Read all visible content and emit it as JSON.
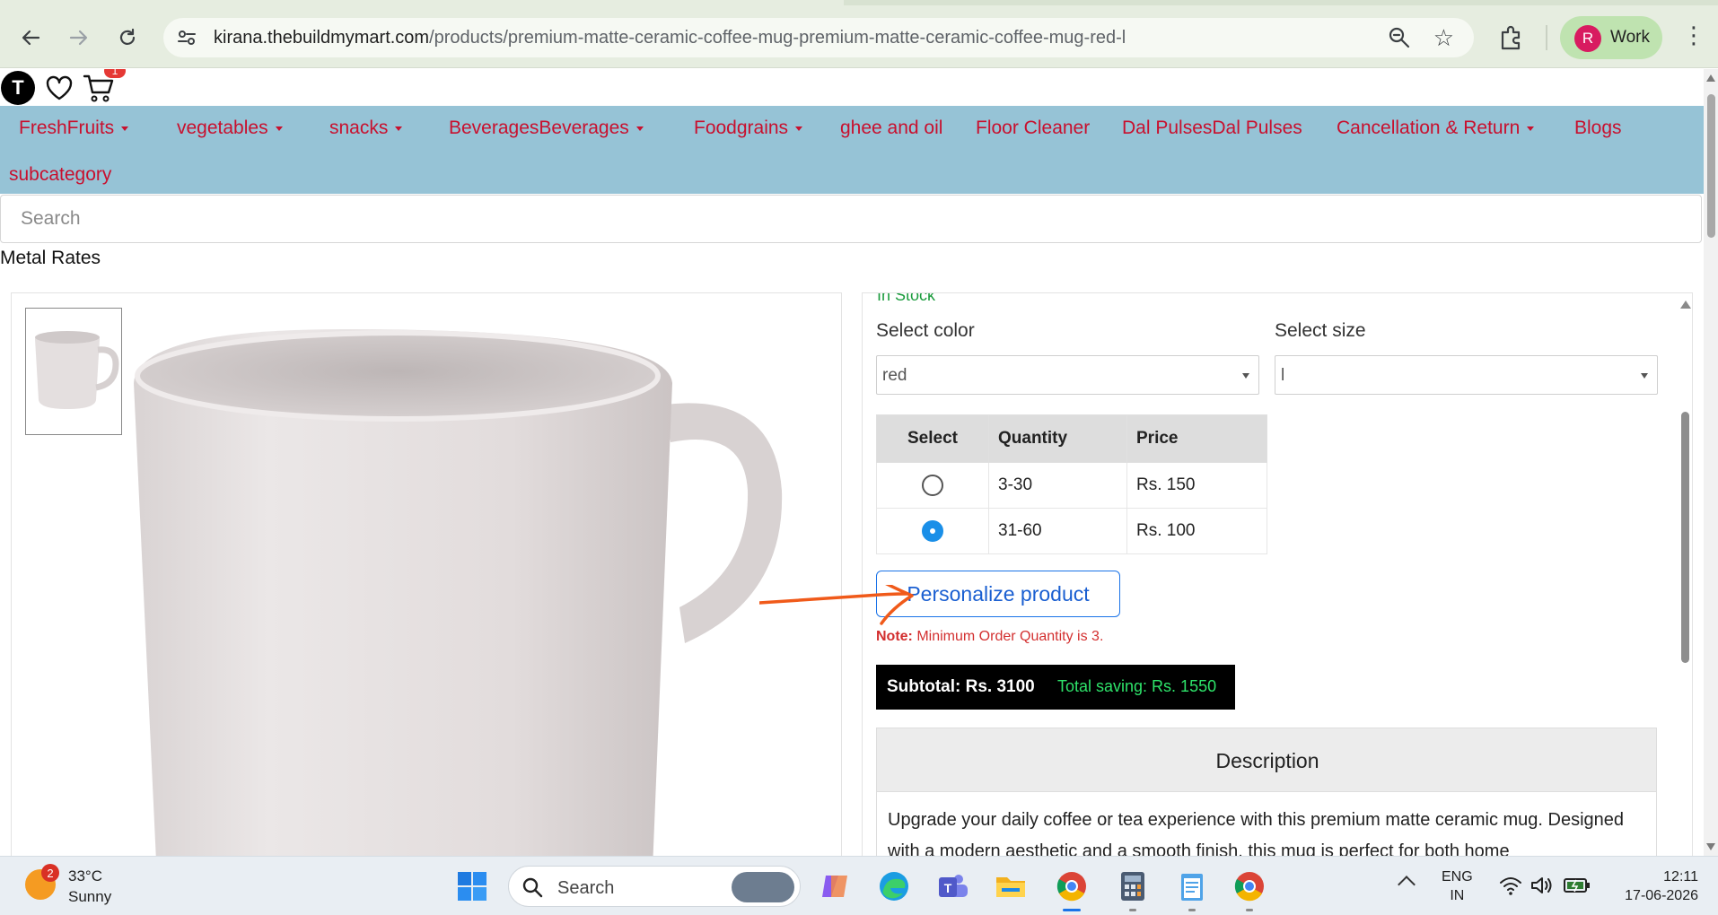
{
  "browser": {
    "url_domain": "kirana.thebuildmymart.com",
    "url_path": "/products/premium-matte-ceramic-coffee-mug-premium-matte-ceramic-coffee-mug-red-l",
    "profile_initial": "R",
    "profile_name": "Work"
  },
  "header": {
    "user_initial": "T",
    "cart_count": "1"
  },
  "nav": {
    "items": [
      {
        "label": "FreshFruits",
        "dropdown": true
      },
      {
        "label": "vegetables",
        "dropdown": true
      },
      {
        "label": "snacks",
        "dropdown": true
      },
      {
        "label": "BeveragesBeverages",
        "dropdown": true
      },
      {
        "label": "Foodgrains",
        "dropdown": true
      },
      {
        "label": "ghee and oil",
        "dropdown": false
      },
      {
        "label": "Floor Cleaner",
        "dropdown": false
      },
      {
        "label": "Dal PulsesDal Pulses",
        "dropdown": false
      },
      {
        "label": "Cancellation & Return",
        "dropdown": true
      },
      {
        "label": "Blogs",
        "dropdown": false
      },
      {
        "label": "subcategory",
        "dropdown": false
      }
    ]
  },
  "search": {
    "placeholder": "Search"
  },
  "metal_rates": "Metal Rates",
  "product": {
    "stock_status": "In Stock",
    "color_label": "Select color",
    "color_value": "red",
    "size_label": "Select size",
    "size_value": "l",
    "table": {
      "headers": [
        "Select",
        "Quantity",
        "Price"
      ],
      "rows": [
        {
          "quantity": "3-30",
          "price": "Rs. 150",
          "selected": false
        },
        {
          "quantity": "31-60",
          "price": "Rs. 100",
          "selected": true
        }
      ]
    },
    "personalize_label": "Personalize product",
    "note_label": "Note:",
    "note_text": "Minimum Order Quantity is 3.",
    "subtotal": "Subtotal: Rs. 3100",
    "total_saving": "Total saving: Rs. 1550",
    "description_title": "Description",
    "description_text": "Upgrade your daily coffee or tea experience with this premium matte ceramic mug. Designed with a modern aesthetic and a smooth finish, this mug is perfect for both home"
  },
  "taskbar": {
    "weather_badge": "2",
    "temperature": "33°C",
    "condition": "Sunny",
    "search_label": "Search",
    "lang_line1": "ENG",
    "lang_line2": "IN",
    "time": "12:11",
    "date": "17-06-2026"
  },
  "colors": {
    "nav_bg": "#96c3d6",
    "nav_text": "#c8102e",
    "stock_green": "#1a9b3c",
    "radio_selected": "#1a8fe8",
    "annotation_arrow": "#f05a1a",
    "saving_green": "#2ee36a"
  }
}
